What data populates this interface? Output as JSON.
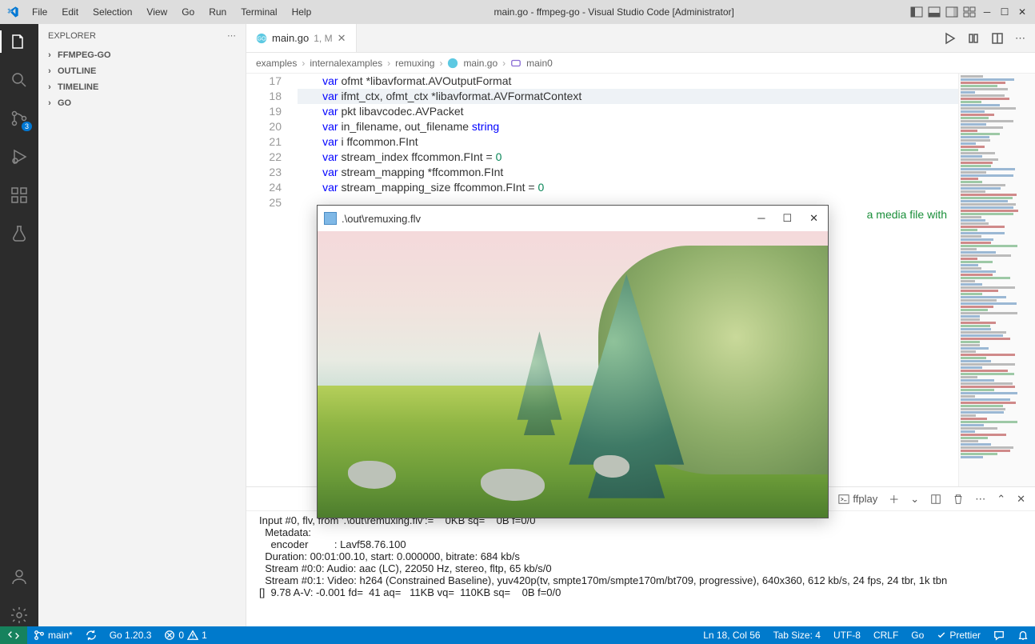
{
  "title": "main.go - ffmpeg-go - Visual Studio Code [Administrator]",
  "menu": [
    "File",
    "Edit",
    "Selection",
    "View",
    "Go",
    "Run",
    "Terminal",
    "Help"
  ],
  "explorer": {
    "title": "EXPLORER",
    "sections": [
      "FFMPEG-GO",
      "OUTLINE",
      "TIMELINE",
      "GO"
    ]
  },
  "tab": {
    "name": "main.go",
    "suffix": "1, M"
  },
  "breadcrumbs": [
    "examples",
    "internalexamples",
    "remuxing",
    "main.go",
    "main0"
  ],
  "lines": {
    "start": 17,
    "rows": [
      {
        "n": 17,
        "pre": "        ",
        "kw": "var",
        "t": " ofmt *libavformat.AVOutputFormat"
      },
      {
        "n": 18,
        "pre": "        ",
        "kw": "var",
        "t": " ifmt_ctx, ofmt_ctx *libavformat.AVFormatContext",
        "hl": true
      },
      {
        "n": 19,
        "pre": "        ",
        "kw": "var",
        "t": " pkt libavcodec.AVPacket"
      },
      {
        "n": 20,
        "pre": "        ",
        "kw": "var",
        "t": " in_filename, out_filename ",
        "typ": "string"
      },
      {
        "n": 21,
        "pre": "        ",
        "kw": "var",
        "t": " i ffcommon.FInt"
      },
      {
        "n": 22,
        "pre": "        ",
        "kw": "var",
        "t": " stream_index ffcommon.FInt = ",
        "num": "0"
      },
      {
        "n": 23,
        "pre": "        ",
        "kw": "var",
        "t": " stream_mapping *ffcommon.FInt"
      },
      {
        "n": 24,
        "pre": "        ",
        "kw": "var",
        "t": " stream_mapping_size ffcommon.FInt = ",
        "num": "0"
      },
      {
        "n": 25,
        "pre": "",
        "t": ""
      }
    ],
    "tailcomment": "a media file with"
  },
  "overlay": {
    "title": ".\\out\\remuxing.flv"
  },
  "terminal": {
    "tab": "ffplay",
    "lines": [
      "Input #0, flv, from '.\\out\\remuxing.flv':=    0KB sq=    0B f=0/0",
      "  Metadata:",
      "    encoder         : Lavf58.76.100",
      "  Duration: 00:01:00.10, start: 0.000000, bitrate: 684 kb/s",
      "  Stream #0:0: Audio: aac (LC), 22050 Hz, stereo, fltp, 65 kb/s/0",
      "  Stream #0:1: Video: h264 (Constrained Baseline), yuv420p(tv, smpte170m/smpte170m/bt709, progressive), 640x360, 612 kb/s, 24 fps, 24 tbr, 1k tbn",
      "[]  9.78 A-V: -0.001 fd=  41 aq=   11KB vq=  110KB sq=    0B f=0/0"
    ]
  },
  "status": {
    "branch": "main*",
    "go": "Go 1.20.3",
    "errs": "0",
    "warns": "1",
    "pos": "Ln 18, Col 56",
    "spaces": "Tab Size: 4",
    "enc": "UTF-8",
    "eol": "CRLF",
    "lang": "Go",
    "prettier": "Prettier"
  },
  "scm_badge": "3"
}
